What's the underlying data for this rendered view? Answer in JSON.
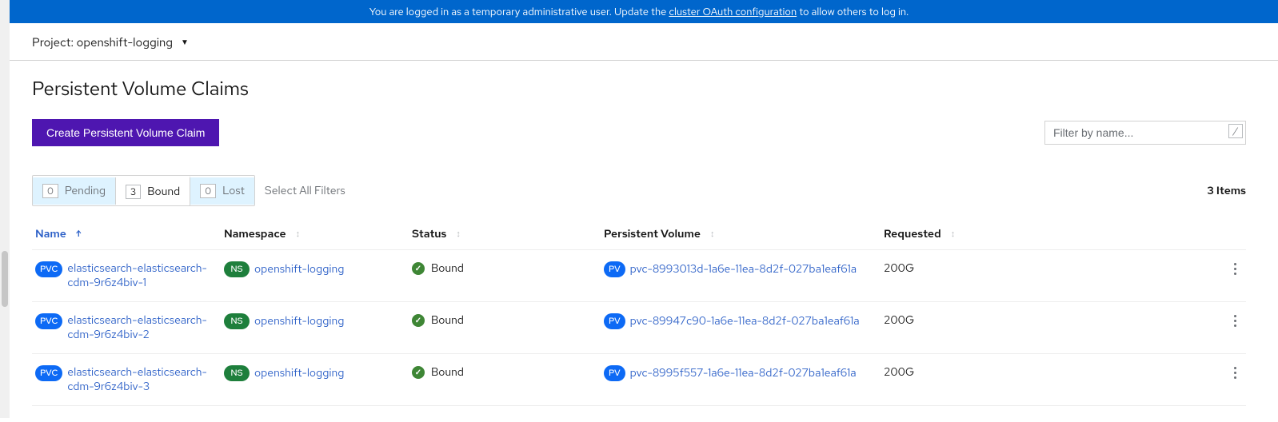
{
  "banner": {
    "prefix": "You are logged in as a temporary administrative user. Update the ",
    "link": "cluster OAuth configuration",
    "suffix": " to allow others to log in."
  },
  "project": {
    "label": "Project:",
    "name": "openshift-logging"
  },
  "page": {
    "title": "Persistent Volume Claims"
  },
  "toolbar": {
    "create_label": "Create Persistent Volume Claim",
    "filter_placeholder": "Filter by name...",
    "slash": "/"
  },
  "filters": {
    "chips": [
      {
        "count": "0",
        "label": "Pending",
        "active": false
      },
      {
        "count": "3",
        "label": "Bound",
        "active": true
      },
      {
        "count": "0",
        "label": "Lost",
        "active": false
      }
    ],
    "select_all": "Select All Filters",
    "items_count": "3 Items"
  },
  "columns": {
    "name": "Name",
    "namespace": "Namespace",
    "status": "Status",
    "pv": "Persistent Volume",
    "requested": "Requested"
  },
  "badges": {
    "pvc": "PVC",
    "ns": "NS",
    "pv": "PV"
  },
  "rows": [
    {
      "name": "elasticsearch-elasticsearch-cdm-9r6z4biv-1",
      "namespace": "openshift-logging",
      "status": "Bound",
      "pv": "pvc-8993013d-1a6e-11ea-8d2f-027ba1eaf61a",
      "requested": "200G"
    },
    {
      "name": "elasticsearch-elasticsearch-cdm-9r6z4biv-2",
      "namespace": "openshift-logging",
      "status": "Bound",
      "pv": "pvc-89947c90-1a6e-11ea-8d2f-027ba1eaf61a",
      "requested": "200G"
    },
    {
      "name": "elasticsearch-elasticsearch-cdm-9r6z4biv-3",
      "namespace": "openshift-logging",
      "status": "Bound",
      "pv": "pvc-8995f557-1a6e-11ea-8d2f-027ba1eaf61a",
      "requested": "200G"
    }
  ]
}
